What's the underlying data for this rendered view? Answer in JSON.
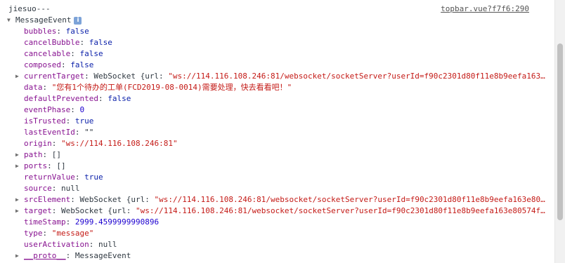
{
  "log": {
    "header_text": "jiesuo---",
    "source": "topbar.vue?f7f6:290",
    "object_name": "MessageEvent",
    "info_icon": "i"
  },
  "props": [
    {
      "key": "bubbles",
      "value": "false",
      "type": "kw",
      "expandable": false
    },
    {
      "key": "cancelBubble",
      "value": "false",
      "type": "kw",
      "expandable": false
    },
    {
      "key": "cancelable",
      "value": "false",
      "type": "kw",
      "expandable": false
    },
    {
      "key": "composed",
      "value": "false",
      "type": "kw",
      "expandable": false
    },
    {
      "key": "currentTarget",
      "value_prefix": "WebSocket {url: ",
      "value": "\"ws://114.116.108.246:81/websocket/socketServer?userId=f90c2301d80f11e8b9eefa163…",
      "type": "obj",
      "expandable": true
    },
    {
      "key": "data",
      "value": "\"您有1个待办的工单(FCD2019-08-0014)需要处理，快去看看吧！\"",
      "type": "str",
      "expandable": false
    },
    {
      "key": "defaultPrevented",
      "value": "false",
      "type": "kw",
      "expandable": false
    },
    {
      "key": "eventPhase",
      "value": "0",
      "type": "num",
      "expandable": false
    },
    {
      "key": "isTrusted",
      "value": "true",
      "type": "kw",
      "expandable": false
    },
    {
      "key": "lastEventId",
      "value": "\"\"",
      "type": "punct",
      "expandable": false
    },
    {
      "key": "origin",
      "value": "\"ws://114.116.108.246:81\"",
      "type": "str",
      "expandable": false
    },
    {
      "key": "path",
      "value": "[]",
      "type": "punct",
      "expandable": true
    },
    {
      "key": "ports",
      "value": "[]",
      "type": "punct",
      "expandable": true
    },
    {
      "key": "returnValue",
      "value": "true",
      "type": "kw",
      "expandable": false
    },
    {
      "key": "source",
      "value": "null",
      "type": "punct",
      "expandable": false
    },
    {
      "key": "srcElement",
      "value_prefix": "WebSocket {url: ",
      "value": "\"ws://114.116.108.246:81/websocket/socketServer?userId=f90c2301d80f11e8b9eefa163e80…",
      "type": "obj",
      "expandable": true
    },
    {
      "key": "target",
      "value_prefix": "WebSocket {url: ",
      "value": "\"ws://114.116.108.246:81/websocket/socketServer?userId=f90c2301d80f11e8b9eefa163e80574f…",
      "type": "obj",
      "expandable": true
    },
    {
      "key": "timeStamp",
      "value": "2999.4599999990896",
      "type": "num",
      "expandable": false
    },
    {
      "key": "type",
      "value": "\"message\"",
      "type": "str",
      "expandable": false
    },
    {
      "key": "userActivation",
      "value": "null",
      "type": "punct",
      "expandable": false
    },
    {
      "key": "__proto__",
      "value": "MessageEvent",
      "type": "punct",
      "expandable": true
    }
  ],
  "colors": {
    "key": "#881391",
    "keyword": "#0d22aa",
    "number": "#1c00cf",
    "string": "#c41a16"
  },
  "icons": {
    "collapsed": "triangle-right-icon",
    "expanded": "triangle-down-icon"
  }
}
